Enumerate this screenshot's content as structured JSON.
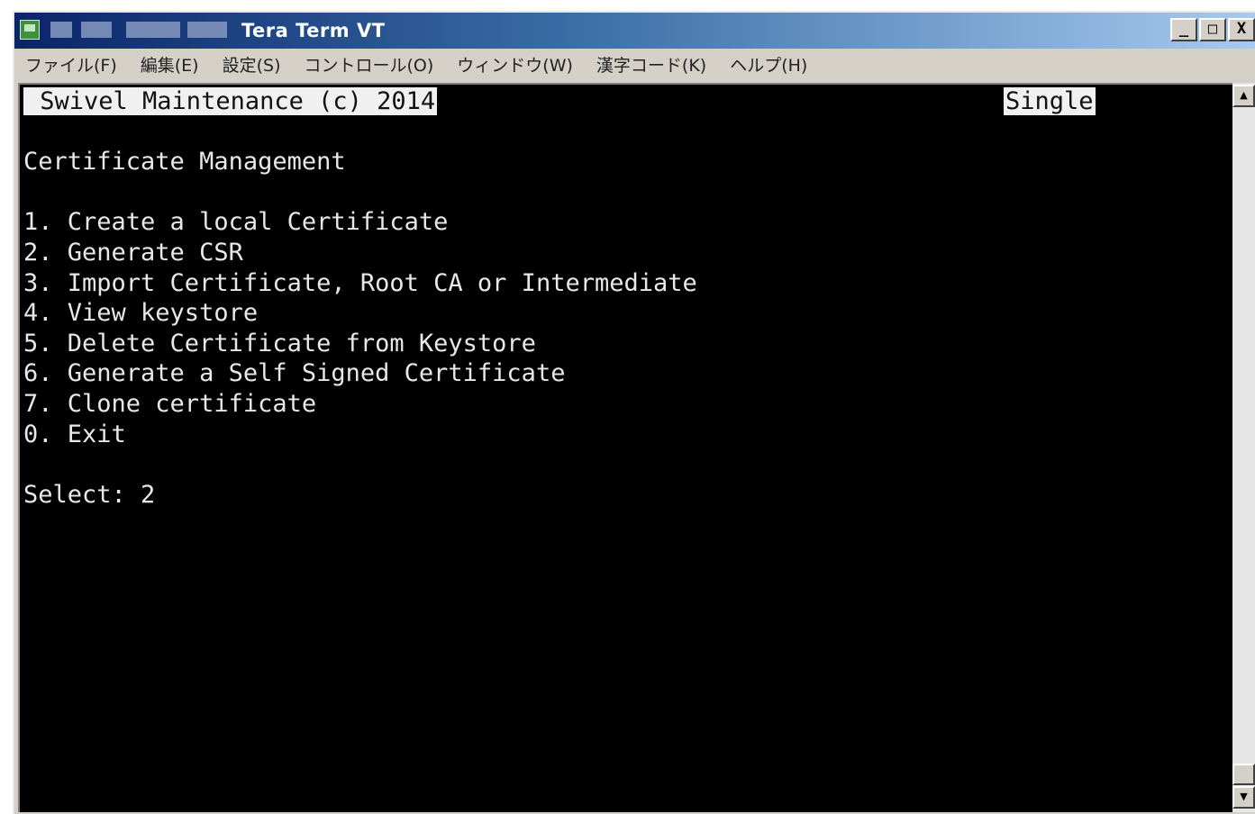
{
  "window": {
    "title": "Tera Term VT",
    "buttons": {
      "minimize": "_",
      "maximize": "□",
      "close": "X"
    }
  },
  "menu": [
    {
      "label": "ファイル(F)"
    },
    {
      "label": "編集(E)"
    },
    {
      "label": "設定(S)"
    },
    {
      "label": "コントロール(O)"
    },
    {
      "label": "ウィンドウ(W)"
    },
    {
      "label": "漢字コード(K)"
    },
    {
      "label": "ヘルプ(H)"
    }
  ],
  "terminal": {
    "header_left": " Swivel Maintenance (c) 2014",
    "header_right": "Single",
    "heading": "Certificate Management",
    "options": [
      "1. Create a local Certificate",
      "2. Generate CSR",
      "3. Import Certificate, Root CA or Intermediate",
      "4. View keystore",
      "5. Delete Certificate from Keystore",
      "6. Generate a Self Signed Certificate",
      "7. Clone certificate",
      "0. Exit"
    ],
    "prompt": "Select: 2"
  },
  "scrollbar": {
    "up_arrow": "▲",
    "down_arrow": "▼"
  },
  "colors": {
    "terminal_bg": "#000000",
    "terminal_fg": "#e8e8e8",
    "titlebar_start": "#0a246a",
    "titlebar_end": "#a6caf0"
  }
}
